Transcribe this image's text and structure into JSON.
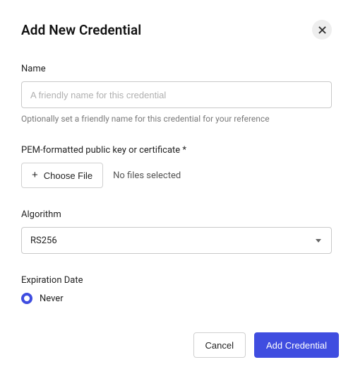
{
  "header": {
    "title": "Add New Credential"
  },
  "name_field": {
    "label": "Name",
    "placeholder": "A friendly name for this credential",
    "hint": "Optionally set a friendly name for this credential for your reference"
  },
  "pem_field": {
    "label": "PEM-formatted public key or certificate *",
    "choose_label": "Choose File",
    "status": "No files selected"
  },
  "algorithm_field": {
    "label": "Algorithm",
    "value": "RS256"
  },
  "expiration_field": {
    "label": "Expiration Date",
    "option_never": "Never"
  },
  "footer": {
    "cancel": "Cancel",
    "submit": "Add Credential"
  }
}
